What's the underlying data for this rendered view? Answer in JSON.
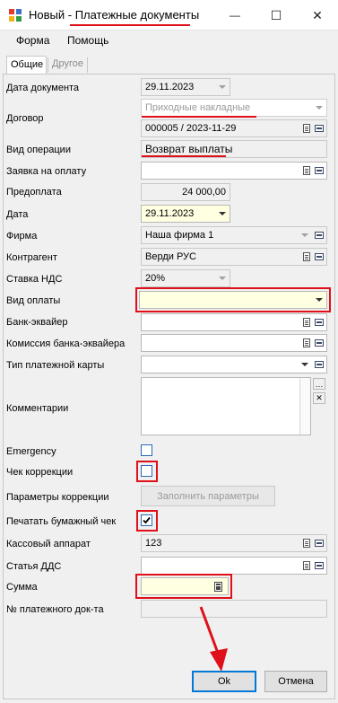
{
  "window": {
    "title_prefix": "Новый - ",
    "title_main": "Платежные документы",
    "minimize_glyph": "—",
    "maximize_glyph": "☐",
    "close_glyph": "✕"
  },
  "menu": {
    "items": [
      "Форма",
      "Помощь"
    ]
  },
  "tabs": [
    {
      "label": "Общие"
    },
    {
      "label": "Другое"
    }
  ],
  "form": {
    "doc_date": {
      "label": "Дата документа",
      "value": "29.11.2023"
    },
    "contract": {
      "label": "Договор",
      "placeholder": "Приходные накладные",
      "value": "000005 / 2023-11-29"
    },
    "operation_type": {
      "label": "Вид операции",
      "value": "Возврат выплаты"
    },
    "payment_request": {
      "label": "Заявка на оплату",
      "value": ""
    },
    "prepayment": {
      "label": "Предоплата",
      "value": "24 000,00"
    },
    "date": {
      "label": "Дата",
      "value": "29.11.2023"
    },
    "company": {
      "label": "Фирма",
      "value": "Наша фирма 1"
    },
    "counterparty": {
      "label": "Контрагент",
      "value": "Верди РУС"
    },
    "vat_rate": {
      "label": "Ставка НДС",
      "value": "20%"
    },
    "payment_type": {
      "label": "Вид оплаты",
      "value": ""
    },
    "acquirer_bank": {
      "label": "Банк-эквайер",
      "value": ""
    },
    "acquirer_fee": {
      "label": "Комиссия банка-эквайера",
      "value": ""
    },
    "card_type": {
      "label": "Тип платежной карты",
      "value": ""
    },
    "comments": {
      "label": "Комментарии",
      "value": ""
    },
    "emergency": {
      "label": "Emergency",
      "checked": false
    },
    "correction_check": {
      "label": "Чек коррекции",
      "checked": false
    },
    "correction_params": {
      "label": "Параметры коррекции",
      "button": "Заполнить параметры"
    },
    "print_paper_check": {
      "label": "Печатать бумажный чек",
      "checked": true
    },
    "cash_register": {
      "label": "Кассовый аппарат",
      "value": "123"
    },
    "cashflow_item": {
      "label": "Статья ДДС",
      "value": ""
    },
    "amount": {
      "label": "Сумма",
      "value": ""
    },
    "payment_doc_no": {
      "label": "№ платежного док-та",
      "value": ""
    }
  },
  "buttons": {
    "ok": "Ok",
    "cancel": "Отмена"
  },
  "colors": {
    "annotation_red": "#e0101a",
    "highlight_yellow": "#ffffe1",
    "checkbox_blue": "#2b67b5"
  },
  "icons": [
    "app-icon",
    "minimize-icon",
    "maximize-icon",
    "close-icon",
    "dropdown-arrow-icon",
    "document-icon",
    "list-icon",
    "calculator-icon",
    "checkmark-icon",
    "ellipsis-icon",
    "clear-icon",
    "red-arrow-annotation"
  ]
}
